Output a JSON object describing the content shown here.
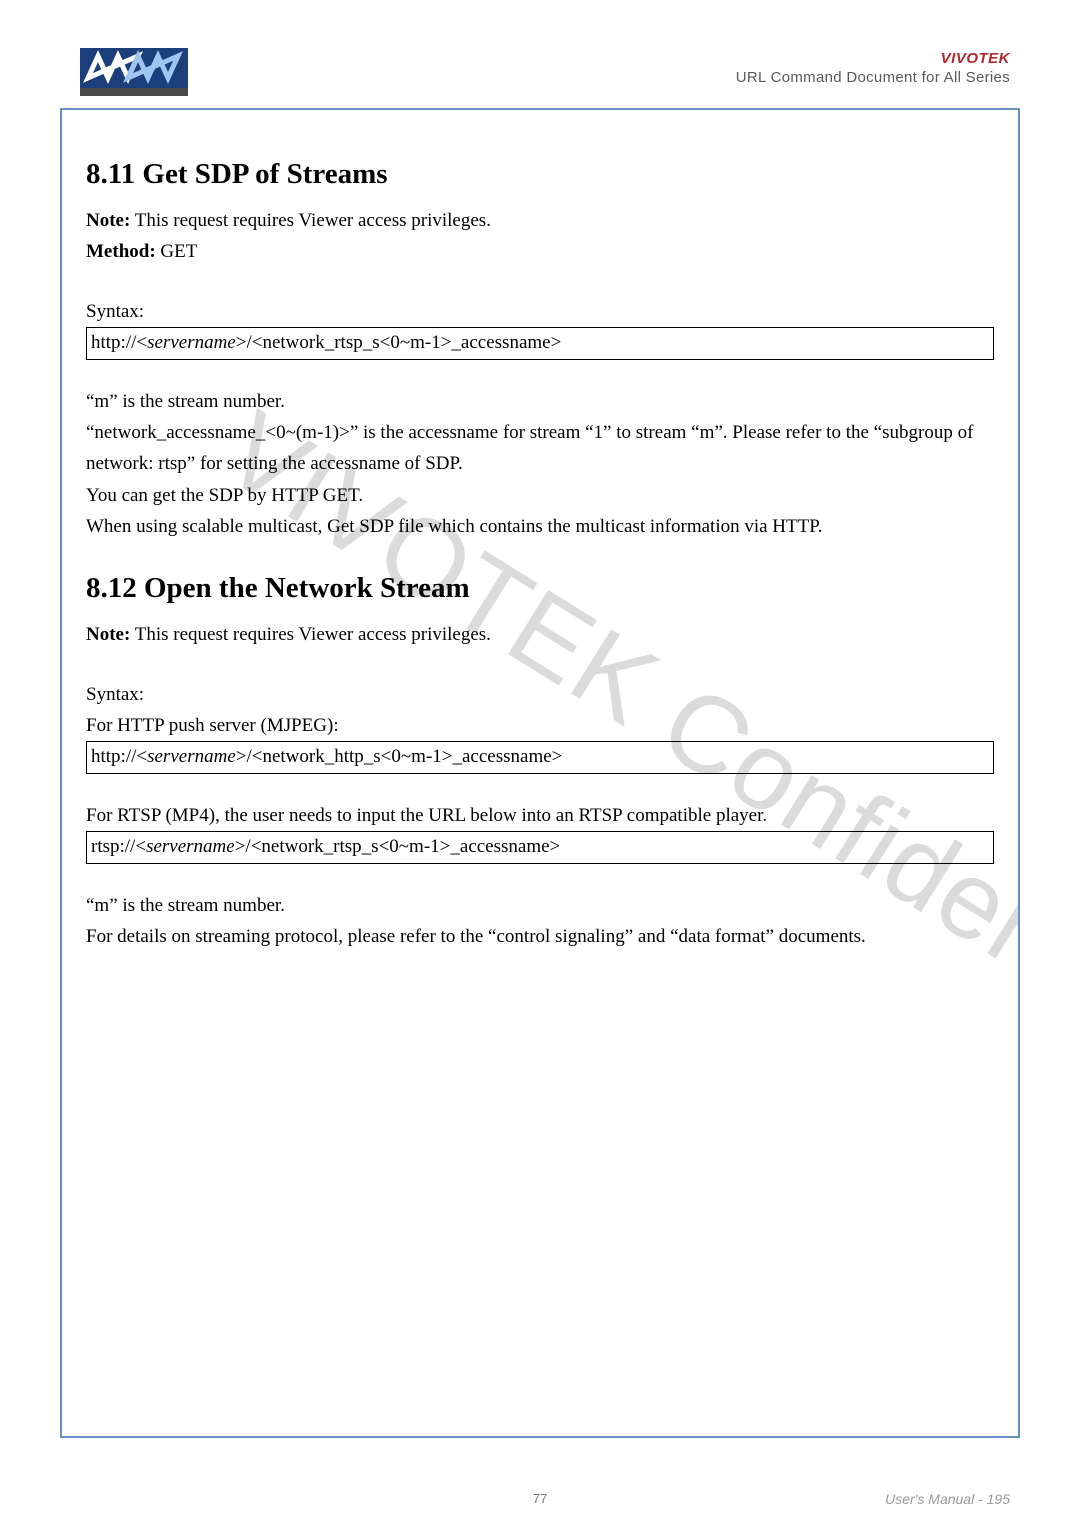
{
  "header": {
    "brand": "VIVOTEK",
    "doc_title": "URL Command Document for All Series"
  },
  "section1": {
    "heading": "8.11 Get SDP of Streams",
    "note_label": "Note:",
    "note_text": " This request requires Viewer access privileges.",
    "method_label": "Method:",
    "method_text": " GET",
    "syntax_label": "Syntax:",
    "code_prefix": "http://<",
    "code_server": "servername",
    "code_suffix": ">/<network_rtsp_s<0~m-1>_accessname>",
    "p1": "“m” is the stream number.",
    "p2": "“network_accessname_<0~(m-1)>” is the accessname for stream “1” to stream “m”. Please refer to the “subgroup of network: rtsp” for setting the accessname of SDP.",
    "p3": "You can get the SDP by HTTP GET.",
    "p4": "When using scalable multicast, Get SDP file which contains the multicast information via HTTP."
  },
  "section2": {
    "heading": "8.12 Open the Network Stream",
    "note_label": "Note:",
    "note_text": " This request requires Viewer access privileges.",
    "syntax_label": "Syntax:",
    "mjpeg_label": "For HTTP push server (MJPEG):",
    "code1_prefix": "http://<",
    "code1_server": "servername",
    "code1_suffix": ">/<network_http_s<0~m-1>_accessname>",
    "rtsp_label": "For RTSP (MP4), the user needs to input the URL below into an RTSP compatible player.",
    "code2_prefix": "rtsp://<",
    "code2_server": "servername",
    "code2_suffix": ">/<network_rtsp_s<0~m-1>_accessname>",
    "p1": "“m” is the stream number.",
    "p2": "For details on streaming protocol, please refer to the “control signaling” and “data format” documents."
  },
  "watermark": "VIVOTEK Confidential",
  "footer": {
    "center": "77",
    "right": "User's Manual - 195"
  }
}
